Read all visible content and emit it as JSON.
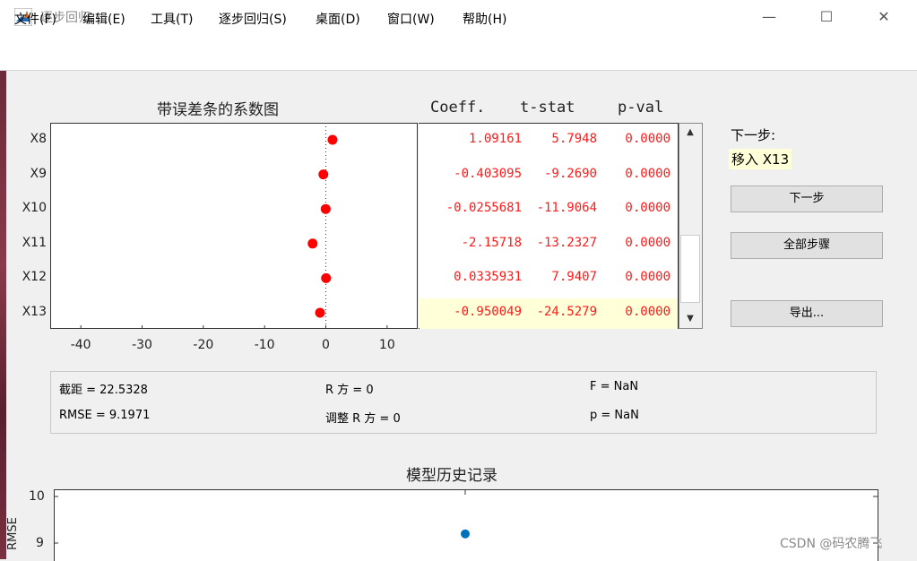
{
  "window": {
    "title": "逐步回归",
    "controls": {
      "minimize": "—",
      "maximize": "☐",
      "close": "✕"
    }
  },
  "menu": [
    "文件(F)",
    "编辑(E)",
    "工具(T)",
    "逐步回归(S)",
    "桌面(D)",
    "窗口(W)",
    "帮助(H)"
  ],
  "coef_plot": {
    "title": "带误差条的系数图",
    "chart_data": {
      "type": "scatter",
      "categories": [
        "X8",
        "X9",
        "X10",
        "X11",
        "X12",
        "X13"
      ],
      "values": [
        1.09161,
        -0.403095,
        -0.0255681,
        -2.15718,
        0.0335931,
        -0.950049
      ],
      "xticks": [
        "-40",
        "-30",
        "-20",
        "-10",
        "0",
        "10"
      ],
      "xlim": [
        -45,
        15
      ],
      "zero_line": "dotted",
      "marker_color": "#ff0000"
    }
  },
  "table": {
    "headers": [
      "Coeff.",
      "t-stat",
      "p-val"
    ],
    "rows": [
      [
        "1.09161",
        "5.7948",
        "0.0000"
      ],
      [
        "-0.403095",
        "-9.2690",
        "0.0000"
      ],
      [
        "-0.0255681",
        "-11.9064",
        "0.0000"
      ],
      [
        "-2.15718",
        "-13.2327",
        "0.0000"
      ],
      [
        "0.0335931",
        "7.9407",
        "0.0000"
      ],
      [
        "-0.950049",
        "-24.5279",
        "0.0000"
      ]
    ],
    "highlight_row": 5,
    "text_color": "#ff1a1a",
    "highlight_color": "#ffffd8"
  },
  "side": {
    "next_step_label": "下一步:",
    "next_step_action": "移入 X13",
    "buttons": {
      "next": "下一步",
      "all": "全部步骤",
      "export": "导出..."
    }
  },
  "stats": {
    "intercept": "截距 = 22.5328",
    "r2": "R 方 = 0",
    "f": "F = NaN",
    "rmse": "RMSE = 9.1971",
    "adj_r2": "调整 R 方 = 0",
    "p": "p = NaN"
  },
  "history": {
    "title": "模型历史记录",
    "chart_data": {
      "type": "scatter",
      "ylabel": "RMSE",
      "yticks": [
        "10",
        "9"
      ],
      "x": [
        1
      ],
      "values": [
        9.1971
      ],
      "marker_color": "#0072bd"
    }
  },
  "watermark": "CSDN @码农腾飞"
}
